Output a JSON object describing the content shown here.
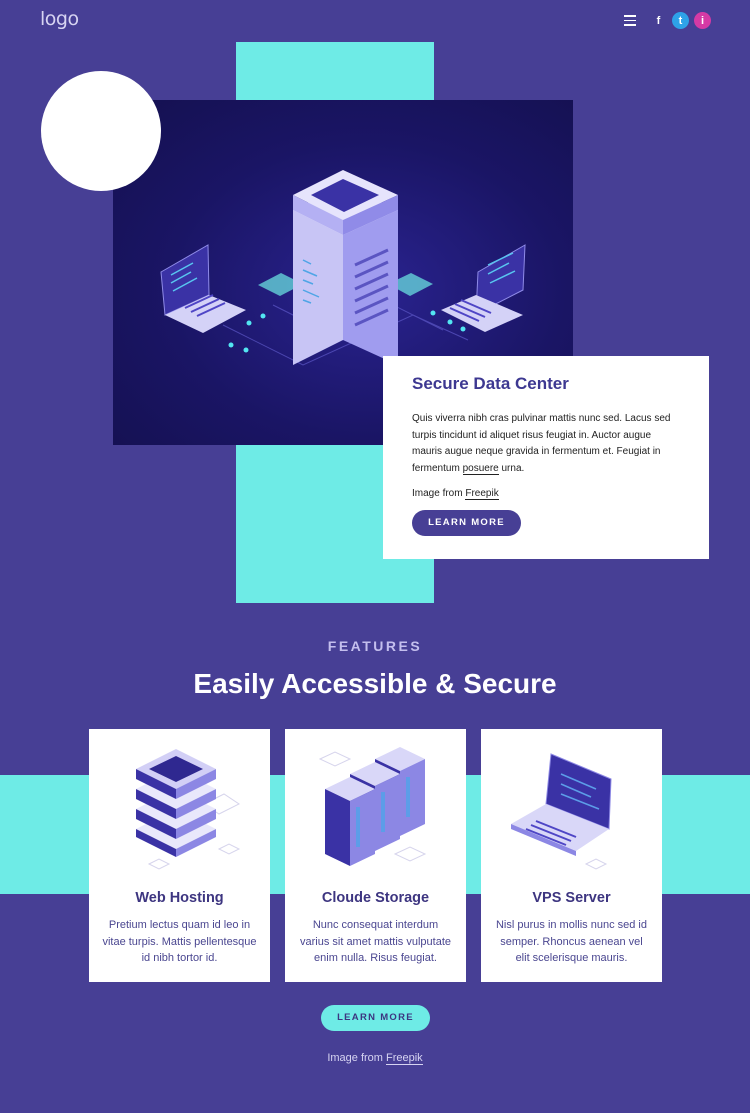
{
  "header": {
    "logo": "logo",
    "social": {
      "facebook": "f",
      "twitter": "t",
      "instagram": "i"
    }
  },
  "hero": {
    "card_title": "Secure Data Center",
    "card_body_before_link": "Quis viverra nibh cras pulvinar mattis nunc sed. Lacus sed turpis tincidunt id aliquet risus feugiat in.  Auctor augue mauris augue neque gravida in fermentum et. Feugiat in fermentum ",
    "card_body_link": "posuere",
    "card_body_after_link": " urna.",
    "credit_prefix": "Image from ",
    "credit_link": "Freepik",
    "button_label": "LEARN MORE"
  },
  "features": {
    "kicker": "FEATURES",
    "title": "Easily Accessible & Secure",
    "cards": [
      {
        "title": "Web Hosting",
        "text": "Pretium lectus quam id leo in vitae turpis. Mattis pellentesque id nibh tortor id."
      },
      {
        "title": "Cloude Storage",
        "text": "Nunc consequat interdum varius sit amet mattis vulputate enim nulla. Risus feugiat."
      },
      {
        "title": "VPS Server",
        "text": "Nisl purus in mollis nunc sed id semper. Rhoncus aenean vel elit scelerisque mauris."
      }
    ],
    "button_label": "LEARN MORE",
    "credit_prefix": "Image from ",
    "credit_link": "Freepik"
  },
  "colors": {
    "background": "#473f95",
    "accent_cyan": "#6eebe6",
    "hero_dark": "#1a1565",
    "card_white": "#ffffff"
  },
  "icons": [
    "menu-icon",
    "facebook-icon",
    "twitter-icon",
    "instagram-icon",
    "data-center-illustration",
    "server-stack-illustration",
    "server-racks-illustration",
    "laptop-illustration"
  ]
}
